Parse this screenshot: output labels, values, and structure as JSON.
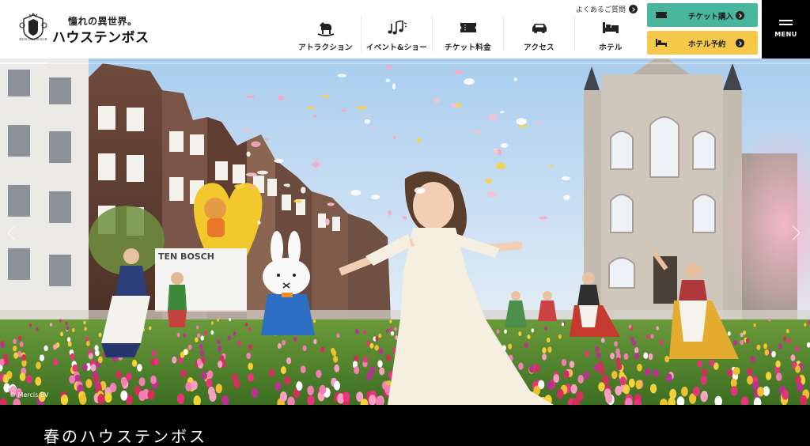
{
  "header": {
    "logo": {
      "crest_text": "HUIS TEN BOSCH",
      "tagline": "憧れの異世界。",
      "name": "ハウステンボス"
    },
    "nav": [
      {
        "label": "アトラクション",
        "icon": "rocking-horse-icon"
      },
      {
        "label": "イベント&ショー",
        "icon": "music-notes-icon"
      },
      {
        "label": "チケット料金",
        "icon": "ticket-icon"
      },
      {
        "label": "アクセス",
        "icon": "car-icon"
      },
      {
        "label": "ホテル",
        "icon": "bed-icon"
      }
    ],
    "faq_label": "よくあるご質問",
    "ticket_button": {
      "label": "チケット購入",
      "icon": "ticket-icon",
      "color": "#48b59d"
    },
    "hotel_button": {
      "label": "ホテル予約",
      "icon": "bed-icon",
      "color": "#f6c94a"
    },
    "menu_label": "MENU"
  },
  "hero": {
    "credit": "© Mercis BV",
    "slides_total": 4,
    "current_slide": 1,
    "slide_progress": 0.6
  },
  "caption": {
    "title": "春のハウステンボス"
  }
}
